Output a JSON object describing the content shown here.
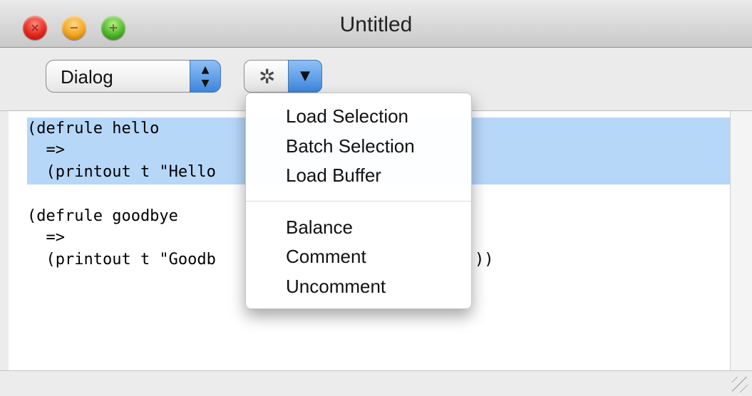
{
  "window": {
    "title": "Untitled"
  },
  "traffic_lights": {
    "close_glyph": "×",
    "minimize_glyph": "−",
    "zoom_glyph": "+"
  },
  "toolbar": {
    "mode_popup": {
      "selected": "Dialog",
      "arrows_glyph": "▲\n▼"
    },
    "action_button": {
      "icon": "gear-icon",
      "icon_glyph": "✲",
      "dropdown_glyph": "▼"
    }
  },
  "editor": {
    "lines": [
      "(defrule hello",
      "  =>",
      "  (printout t \"Hello",
      "(defrule goodbye",
      "  =>",
      "  (printout t \"Goodb",
      "))"
    ]
  },
  "menu": {
    "groups": [
      [
        "Load Selection",
        "Batch Selection",
        "Load Buffer"
      ],
      [
        "Balance",
        "Comment",
        "Uncomment"
      ]
    ]
  },
  "colors": {
    "selection": "#b7d7f9",
    "accent": "#3d86dc"
  }
}
